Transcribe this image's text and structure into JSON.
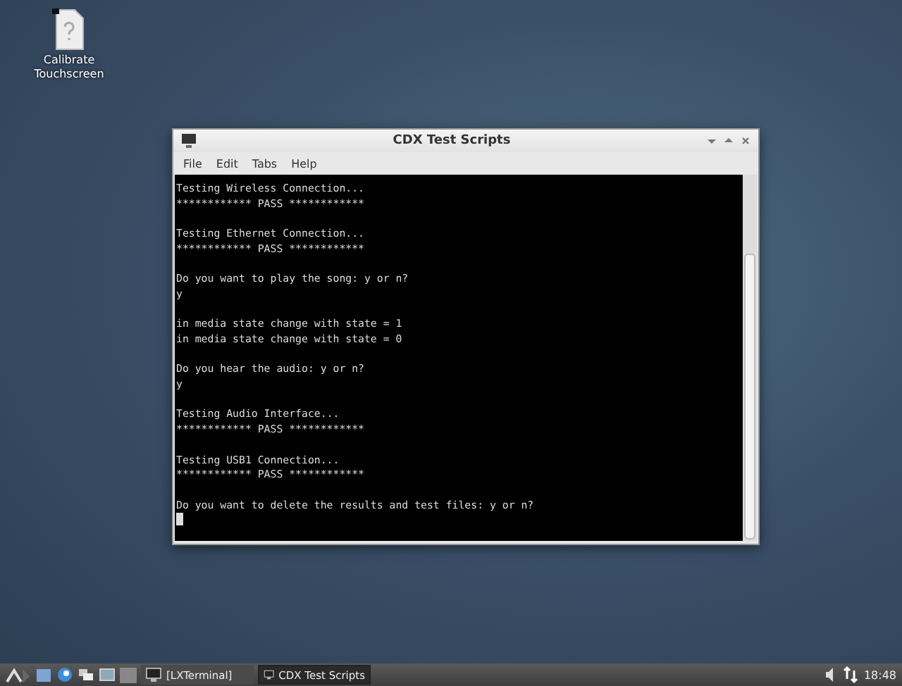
{
  "desktop_icons": [
    {
      "label": "Calibrate Touchscreen"
    }
  ],
  "window": {
    "title": "CDX Test Scripts",
    "menu": [
      "File",
      "Edit",
      "Tabs",
      "Help"
    ],
    "terminal": {
      "blocks": [
        [
          "Testing Wireless Connection...",
          "************ PASS ************"
        ],
        [
          "Testing Ethernet Connection...",
          "************ PASS ************"
        ],
        [
          "Do you want to play the song: y or n?",
          "y"
        ],
        [
          "in media state change with state = 1",
          "in media state change with state = 0"
        ],
        [
          "Do you hear the audio: y or n?",
          "y"
        ],
        [
          "Testing Audio Interface...",
          "************ PASS ************"
        ],
        [
          "Testing USB1 Connection...",
          "************ PASS ************"
        ],
        [
          "Do you want to delete the results and test files: y or n?"
        ]
      ]
    }
  },
  "taskbar": {
    "tasks": [
      {
        "label": "[LXTerminal]",
        "selected": false
      },
      {
        "label": "CDX Test Scripts",
        "selected": true
      }
    ],
    "clock": "18:48"
  }
}
